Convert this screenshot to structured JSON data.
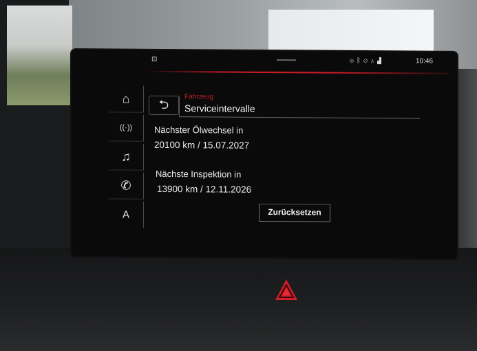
{
  "status_bar": {
    "time": "10:46",
    "icons": [
      "car-icon",
      "location-icon",
      "bluetooth-icon",
      "mute-icon",
      "user-icon",
      "signal-icon"
    ]
  },
  "nav": {
    "items": [
      {
        "id": "home",
        "icon": "home-icon",
        "glyph": "⌂"
      },
      {
        "id": "radio",
        "icon": "radio-icon",
        "glyph": "((·))"
      },
      {
        "id": "media",
        "icon": "music-note-icon",
        "glyph": "♫"
      },
      {
        "id": "phone",
        "icon": "phone-icon",
        "glyph": "✆"
      },
      {
        "id": "navigation",
        "icon": "navigation-arrow-icon",
        "glyph": "A"
      }
    ]
  },
  "header": {
    "breadcrumb": "Fahrzeug",
    "title": "Serviceintervalle",
    "back_glyph": "⮌"
  },
  "service": {
    "oil_change_label": "Nächster Ölwechsel in",
    "oil_change_value": "20100 km / 15.07.2027",
    "inspection_label": "Nächste Inspektion in",
    "inspection_value": "13900 km / 12.11.2026",
    "reset_label": "Zurücksetzen"
  },
  "colors": {
    "accent": "#c41a25",
    "text": "#ececec",
    "screen_bg": "#0a0a0b"
  }
}
